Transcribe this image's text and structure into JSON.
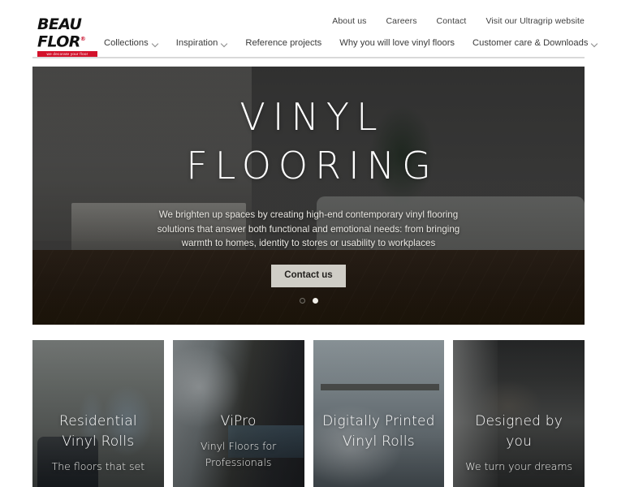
{
  "header": {
    "logo": {
      "line1": "BEAU",
      "line2": "FLOR",
      "registered": "®",
      "tagline": "we decorate your floor"
    },
    "utility_links": [
      {
        "label": "About us"
      },
      {
        "label": "Careers"
      },
      {
        "label": "Contact"
      },
      {
        "label": "Visit our Ultragrip website"
      }
    ],
    "nav_items": [
      {
        "label": "Collections",
        "has_dropdown": true
      },
      {
        "label": "Inspiration",
        "has_dropdown": true
      },
      {
        "label": "Reference projects",
        "has_dropdown": false
      },
      {
        "label": "Why you will love vinyl floors",
        "has_dropdown": false
      },
      {
        "label": "Customer care & Downloads",
        "has_dropdown": true
      }
    ]
  },
  "hero": {
    "title_line1": "VINYL",
    "title_line2": "FLOORING",
    "description": "We brighten up spaces by creating high-end contemporary vinyl flooring solutions that answer both functional and emotional needs: from bringing warmth to homes, identity to stores or usability to workplaces",
    "cta_label": "Contact us",
    "slides": [
      {
        "active": false
      },
      {
        "active": true
      }
    ]
  },
  "cards": [
    {
      "title": "Residential Vinyl Rolls",
      "subtitle": "The floors that set"
    },
    {
      "title": "ViPro",
      "subtitle": "Vinyl Floors for Professionals"
    },
    {
      "title": "Digitally Printed Vinyl Rolls",
      "subtitle": ""
    },
    {
      "title": "Designed by you",
      "subtitle": "We turn your dreams"
    }
  ],
  "colors": {
    "brand_red": "#d3122b",
    "text_dark": "#3b3b3b",
    "rule": "#d9d9d9"
  }
}
